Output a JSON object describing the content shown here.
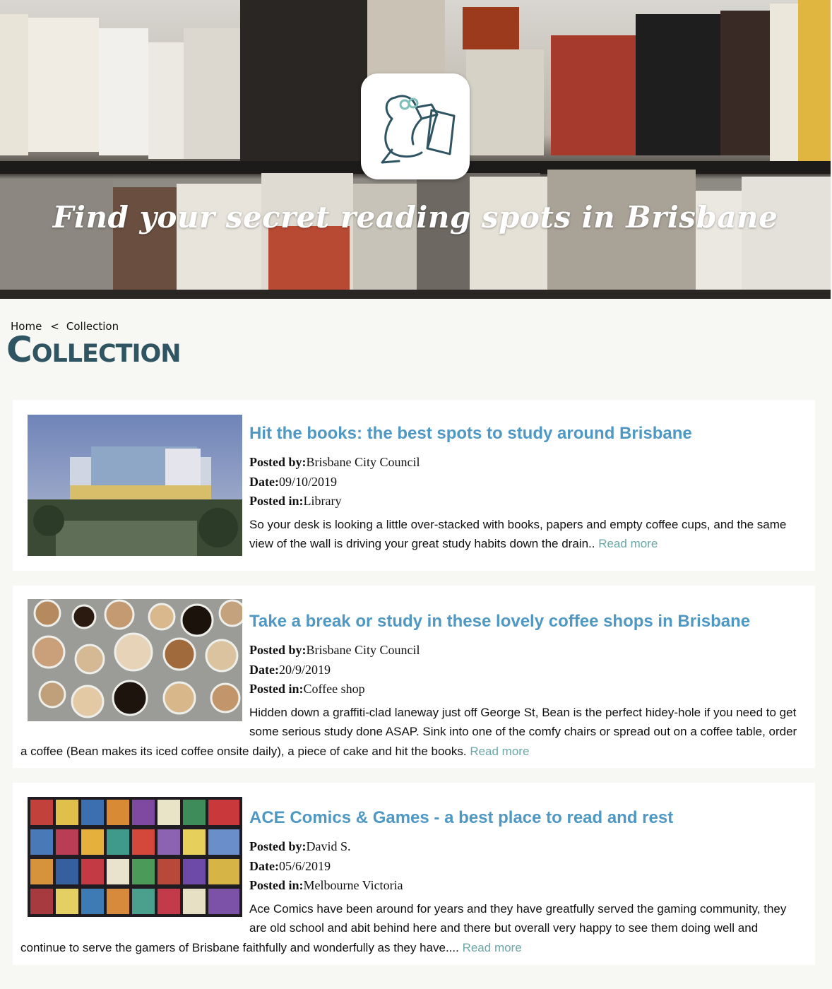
{
  "hero": {
    "tagline": "Find your secret reading spots in Brisbane"
  },
  "breadcrumb": {
    "home": "Home",
    "separator": "<",
    "current": "Collection"
  },
  "page_title": "Collection",
  "posts": [
    {
      "title": "Hit the books: the best spots to study around Brisbane",
      "posted_by_label": "Posted by:",
      "posted_by": "Brisbane City Council",
      "date_label": "Date:",
      "date": "09/10/2019",
      "posted_in_label": "Posted in:",
      "posted_in": "Library",
      "excerpt": "So your desk is looking a little over-stacked with books, papers and empty coffee cups, and the same view of the wall is driving your great study habits down the drain.. ",
      "read_more": "Read more"
    },
    {
      "title": "Take a break or study in these lovely coffee shops in Brisbane",
      "posted_by_label": "Posted by:",
      "posted_by": "Brisbane City Council",
      "date_label": "Date:",
      "date": "20/9/2019",
      "posted_in_label": "Posted in:",
      "posted_in": "Coffee shop",
      "excerpt": "Hidden down a graffiti-clad laneway just off George St, Bean is the perfect hidey-hole if you need to get some serious study done ASAP. Sink into one of the comfy chairs or spread out on a coffee table, order a coffee (Bean makes its iced coffee onsite daily), a piece of cake and hit the books. ",
      "read_more": "Read more"
    },
    {
      "title": "ACE Comics & Games - a best place to read and rest",
      "posted_by_label": "Posted by:",
      "posted_by": "David S.",
      "date_label": "Date:",
      "date": "05/6/2019",
      "posted_in_label": "Posted in:",
      "posted_in": "Melbourne Victoria",
      "excerpt": "Ace Comics have been around for years and they have greatfully served the gaming community, they are old school and abit behind here and there but overall very happy to see them doing well and continue to serve the gamers of Brisbane faithfully and wonderfully as they have.... ",
      "read_more": "Read more"
    }
  ],
  "colors": {
    "title_link": "#4f98c4",
    "read_more": "#6aa7a8",
    "heading": "#2f5462",
    "page_bg": "#f7f7f3"
  }
}
